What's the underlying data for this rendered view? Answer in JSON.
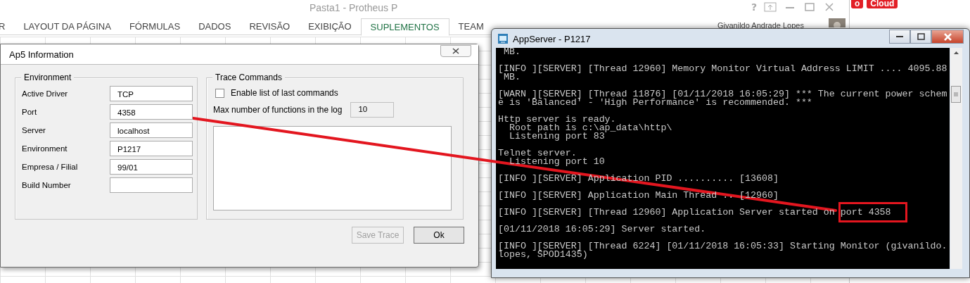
{
  "excel": {
    "title": "Pasta1 - Protheus P",
    "tabs": [
      {
        "label": "R",
        "selected": false
      },
      {
        "label": "LAYOUT DA PÁGINA",
        "selected": false
      },
      {
        "label": "FÓRMULAS",
        "selected": false
      },
      {
        "label": "DADOS",
        "selected": false
      },
      {
        "label": "REVISÃO",
        "selected": false
      },
      {
        "label": "EXIBIÇÃO",
        "selected": false
      },
      {
        "label": "SUPLEMENTOS",
        "selected": true
      },
      {
        "label": "TEAM",
        "selected": false
      }
    ],
    "help": "?",
    "user": "Givanildo Andrade Lopes"
  },
  "background_buttons": [
    "o",
    "Cloud"
  ],
  "dialog": {
    "title": "Ap5 Information",
    "environment": {
      "title": "Environment",
      "fields": [
        {
          "label": "Active Driver",
          "value": "TCP"
        },
        {
          "label": "Port",
          "value": "4358"
        },
        {
          "label": "Server",
          "value": "localhost"
        },
        {
          "label": "Environment",
          "value": "P1217"
        },
        {
          "label": "Empresa / Filial",
          "value": "99/01"
        },
        {
          "label": "Build Number"
        }
      ]
    },
    "trace": {
      "title": "Trace Commands",
      "checkbox": {
        "label": "Enable list of last commands",
        "checked": false
      },
      "max_label": "Max number of functions in the log",
      "max_value": "10"
    },
    "buttons": [
      {
        "label": "Save Trace",
        "disabled": true
      },
      {
        "label": "Ok",
        "disabled": false
      }
    ]
  },
  "console": {
    "title": "AppServer - P1217",
    "paragraphs": [
      {
        "lines": [
          " MB."
        ]
      },
      {
        "lines": [
          "[INFO ][SERVER] [Thread 12960] Memory Monitor Virtual Address LIMIT .... 4095.88",
          " MB."
        ]
      },
      {
        "lines": [
          "[WARN ][SERVER] [Thread 11876] [01/11/2018 16:05:29] *** The current power schem",
          "e is 'Balanced' - 'High Performance' is recommended. ***"
        ]
      },
      {
        "lines": [
          "Http server is ready.",
          "  Root path is c:\\ap_data\\http\\",
          "  Listening port 83"
        ]
      },
      {
        "lines": [
          "Telnet server.",
          "  Listening port 10"
        ]
      },
      {
        "lines": [
          "[INFO ][SERVER] Application PID .......... [13608]"
        ]
      },
      {
        "lines": [
          "[INFO ][SERVER] Application Main Thread .. [12960]"
        ]
      },
      {
        "lines": [
          "[INFO ][SERVER] [Thread 12960] Application Server started on "
        ],
        "boxed": "port 4358"
      },
      {
        "lines": [
          "[01/11/2018 16:05:29] Server started."
        ]
      },
      {
        "lines": [
          "[INFO ][SERVER] [Thread 6224] [01/11/2018 16:05:33] Starting Monitor (givanildo.",
          "lopes, SPOD1435)"
        ]
      }
    ]
  }
}
